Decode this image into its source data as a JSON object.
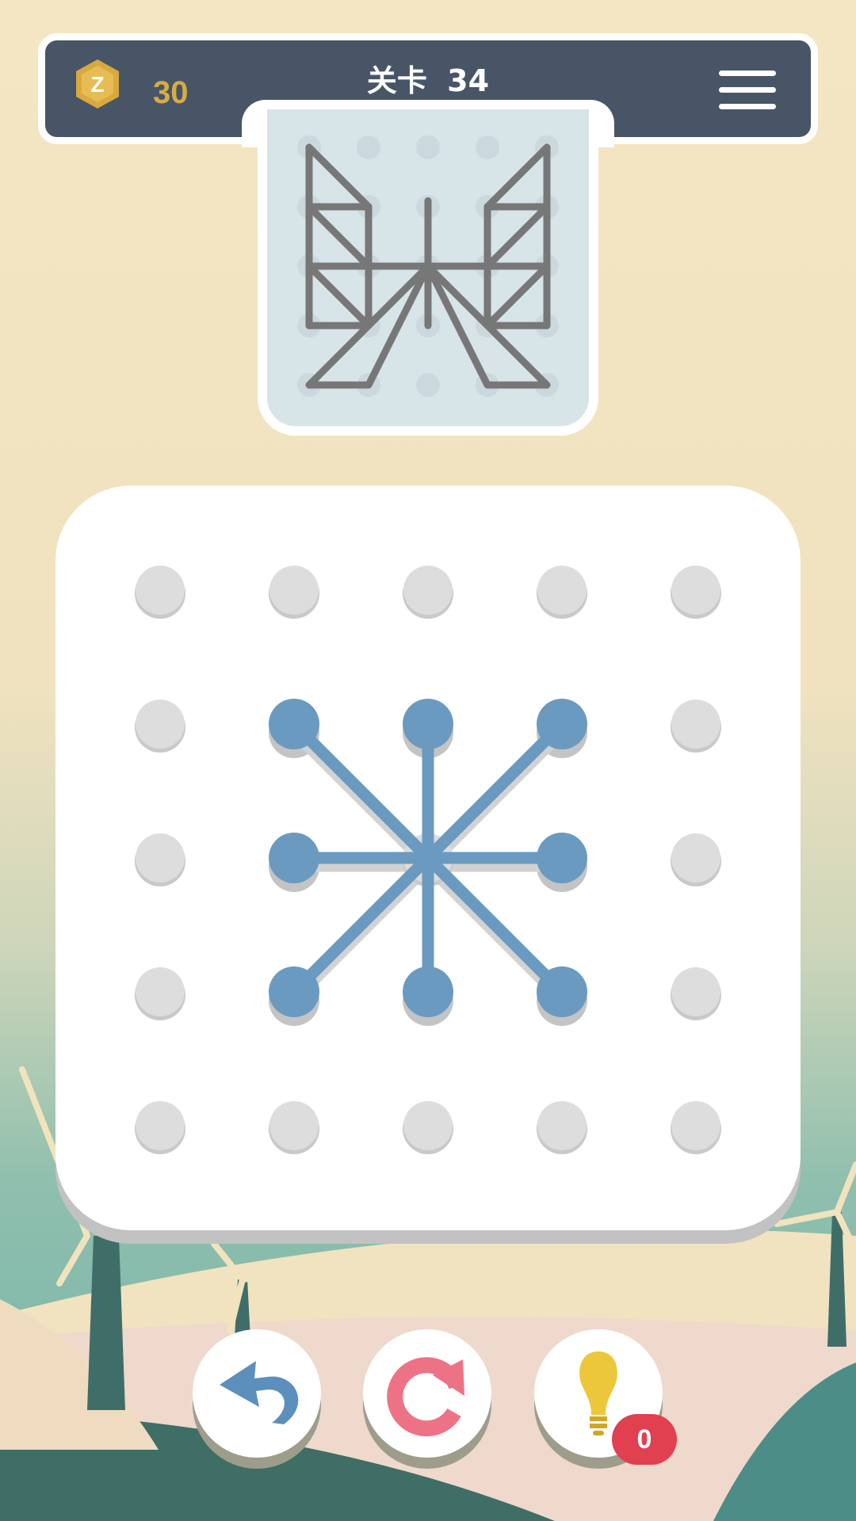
{
  "header": {
    "coins": "30",
    "coin_icon": "hexagon-coin-icon",
    "level_prefix": "关卡",
    "level_number": "34",
    "menu_icon": "hamburger-menu-icon"
  },
  "preview": {
    "grid_size": 5,
    "lines": [
      [
        [
          0,
          0
        ],
        [
          0,
          3
        ]
      ],
      [
        [
          0,
          0
        ],
        [
          1,
          1
        ]
      ],
      [
        [
          0,
          1
        ],
        [
          1,
          1
        ]
      ],
      [
        [
          0,
          2
        ],
        [
          4,
          2
        ]
      ],
      [
        [
          0,
          3
        ],
        [
          1,
          3
        ]
      ],
      [
        [
          0,
          1
        ],
        [
          1,
          2
        ]
      ],
      [
        [
          0,
          2
        ],
        [
          1,
          3
        ]
      ],
      [
        [
          1,
          1
        ],
        [
          1,
          3
        ]
      ],
      [
        [
          1,
          3
        ],
        [
          0,
          4
        ]
      ],
      [
        [
          0,
          4
        ],
        [
          1,
          4
        ]
      ],
      [
        [
          1,
          4
        ],
        [
          2,
          2
        ]
      ],
      [
        [
          2,
          0.9
        ],
        [
          2,
          3
        ]
      ],
      [
        [
          2,
          2
        ],
        [
          3,
          4
        ]
      ],
      [
        [
          3,
          4
        ],
        [
          4,
          4
        ]
      ],
      [
        [
          4,
          4
        ],
        [
          3,
          3
        ]
      ],
      [
        [
          3,
          3
        ],
        [
          4,
          3
        ]
      ],
      [
        [
          4,
          0
        ],
        [
          4,
          3
        ]
      ],
      [
        [
          4,
          0
        ],
        [
          3,
          1
        ]
      ],
      [
        [
          3,
          1
        ],
        [
          4,
          1
        ]
      ],
      [
        [
          3,
          1
        ],
        [
          3,
          3
        ]
      ],
      [
        [
          4,
          1
        ],
        [
          3,
          2
        ]
      ],
      [
        [
          4,
          2
        ],
        [
          3,
          3
        ]
      ],
      [
        [
          1,
          2
        ],
        [
          2,
          2
        ]
      ],
      [
        [
          2,
          2
        ],
        [
          3,
          2
        ]
      ],
      [
        [
          1,
          3
        ],
        [
          2,
          2
        ]
      ],
      [
        [
          3,
          3
        ],
        [
          2,
          2
        ]
      ]
    ]
  },
  "board": {
    "grid_size": 5,
    "active_nodes": [
      [
        1,
        1
      ],
      [
        2,
        1
      ],
      [
        3,
        1
      ],
      [
        1,
        2
      ],
      [
        3,
        2
      ],
      [
        1,
        3
      ],
      [
        2,
        3
      ],
      [
        3,
        3
      ]
    ],
    "lines": [
      [
        [
          1,
          1
        ],
        [
          3,
          3
        ]
      ],
      [
        [
          3,
          1
        ],
        [
          1,
          3
        ]
      ],
      [
        [
          2,
          1
        ],
        [
          2,
          3
        ]
      ],
      [
        [
          1,
          2
        ],
        [
          3,
          2
        ]
      ]
    ]
  },
  "controls": {
    "undo_icon": "undo-arrow-icon",
    "reset_icon": "restart-icon",
    "hint_icon": "lightbulb-icon",
    "hint_count": "0"
  },
  "colors": {
    "accent": "#6a9ac0",
    "inactive_dot": "#dddddd",
    "preview_line": "#777777",
    "topbar": "#475567",
    "coin": "#d7ab45",
    "badge": "#e0404f"
  }
}
